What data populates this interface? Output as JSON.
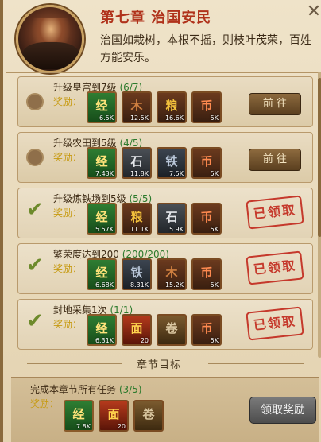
{
  "header": {
    "chapter_title": "第七章 治国安民",
    "description": "治国如栽树，本根不摇，则枝叶茂荣，百姓方能安乐。",
    "close_icon": "✕"
  },
  "tasks": [
    {
      "title": "升级皇宫到7级",
      "progress": "(6/7)",
      "reward_label": "奖励：",
      "status": "incomplete",
      "action": "前 往",
      "items": [
        {
          "type": "book",
          "glyph": "经",
          "qty": "6.5K"
        },
        {
          "type": "wood",
          "glyph": "木",
          "qty": "12.5K"
        },
        {
          "type": "grain",
          "glyph": "粮",
          "qty": "16.6K"
        },
        {
          "type": "coin",
          "glyph": "币",
          "qty": "5K"
        }
      ]
    },
    {
      "title": "升级农田到5级",
      "progress": "(4/5)",
      "reward_label": "奖励：",
      "status": "incomplete",
      "action": "前 往",
      "items": [
        {
          "type": "book",
          "glyph": "经",
          "qty": "7.43K"
        },
        {
          "type": "stone",
          "glyph": "石",
          "qty": "11.8K"
        },
        {
          "type": "iron",
          "glyph": "铁",
          "qty": "7.5K"
        },
        {
          "type": "coin",
          "glyph": "币",
          "qty": "5K"
        }
      ]
    },
    {
      "title": "升级炼铁场到5级",
      "progress": "(5/5)",
      "reward_label": "奖励：",
      "status": "claimed",
      "stamp": "已领取",
      "items": [
        {
          "type": "book",
          "glyph": "经",
          "qty": "5.57K"
        },
        {
          "type": "grain",
          "glyph": "粮",
          "qty": "11.1K"
        },
        {
          "type": "stone",
          "glyph": "石",
          "qty": "5.9K"
        },
        {
          "type": "coin",
          "glyph": "币",
          "qty": "5K"
        }
      ]
    },
    {
      "title": "繁荣度达到200",
      "progress": "(200/200)",
      "reward_label": "奖励：",
      "status": "claimed",
      "stamp": "已领取",
      "items": [
        {
          "type": "book",
          "glyph": "经",
          "qty": "6.68K"
        },
        {
          "type": "iron",
          "glyph": "铁",
          "qty": "8.31K"
        },
        {
          "type": "wood",
          "glyph": "木",
          "qty": "15.2K"
        },
        {
          "type": "coin",
          "glyph": "币",
          "qty": "5K"
        }
      ]
    },
    {
      "title": "封地采集1次",
      "progress": "(1/1)",
      "reward_label": "奖励：",
      "status": "claimed",
      "stamp": "已领取",
      "items": [
        {
          "type": "book",
          "glyph": "经",
          "qty": "6.31K"
        },
        {
          "type": "mask",
          "glyph": "面",
          "qty": "20"
        },
        {
          "type": "scroll",
          "glyph": "卷",
          "qty": ""
        },
        {
          "type": "coin",
          "glyph": "币",
          "qty": "5K"
        }
      ]
    }
  ],
  "goal": {
    "section_title": "章节目标",
    "task_title": "完成本章节所有任务",
    "progress": "(3/5)",
    "reward_label": "奖励：",
    "claim_label": "领取奖励",
    "items": [
      {
        "type": "book",
        "glyph": "经",
        "qty": "7.8K"
      },
      {
        "type": "mask",
        "glyph": "面",
        "qty": "20"
      },
      {
        "type": "scroll",
        "glyph": "卷",
        "qty": ""
      }
    ]
  }
}
